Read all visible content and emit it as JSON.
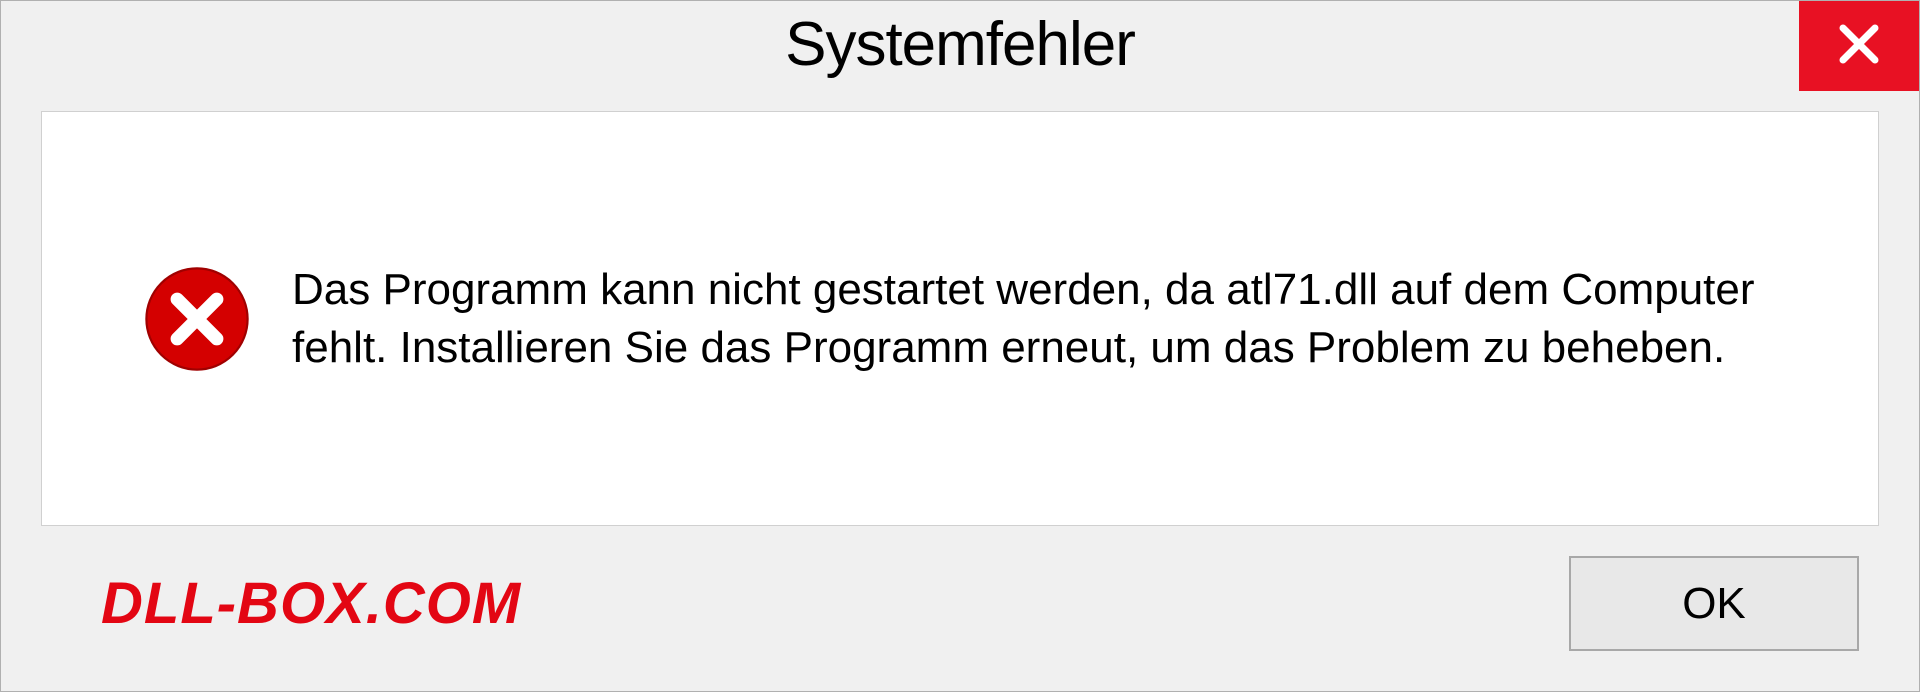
{
  "dialog": {
    "title": "Systemfehler",
    "message": "Das Programm kann nicht gestartet werden, da atl71.dll auf dem Computer fehlt. Installieren Sie das Programm erneut, um das Problem zu beheben.",
    "ok_label": "OK"
  },
  "watermark": "DLL-BOX.COM",
  "colors": {
    "close_bg": "#e81123",
    "error_icon": "#d40000",
    "watermark": "#e30613"
  }
}
